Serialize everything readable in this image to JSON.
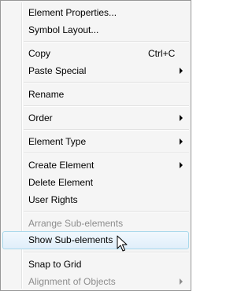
{
  "menu": {
    "element_properties": "Element Properties...",
    "symbol_layout": "Symbol Layout...",
    "copy": "Copy",
    "copy_shortcut": "Ctrl+C",
    "paste_special": "Paste Special",
    "rename": "Rename",
    "order": "Order",
    "element_type": "Element Type",
    "create_element": "Create Element",
    "delete_element": "Delete Element",
    "user_rights": "User Rights",
    "arrange_sub_elements": "Arrange Sub-elements",
    "show_sub_elements": "Show Sub-elements",
    "snap_to_grid": "Snap to Grid",
    "alignment_of_objects": "Alignment of Objects"
  },
  "icons": {
    "submenu": "chevron-right-icon",
    "cursor": "mouse-pointer-icon"
  },
  "colors": {
    "hover_border": "#a8d8eb",
    "disabled_text": "#8d8d8d"
  }
}
